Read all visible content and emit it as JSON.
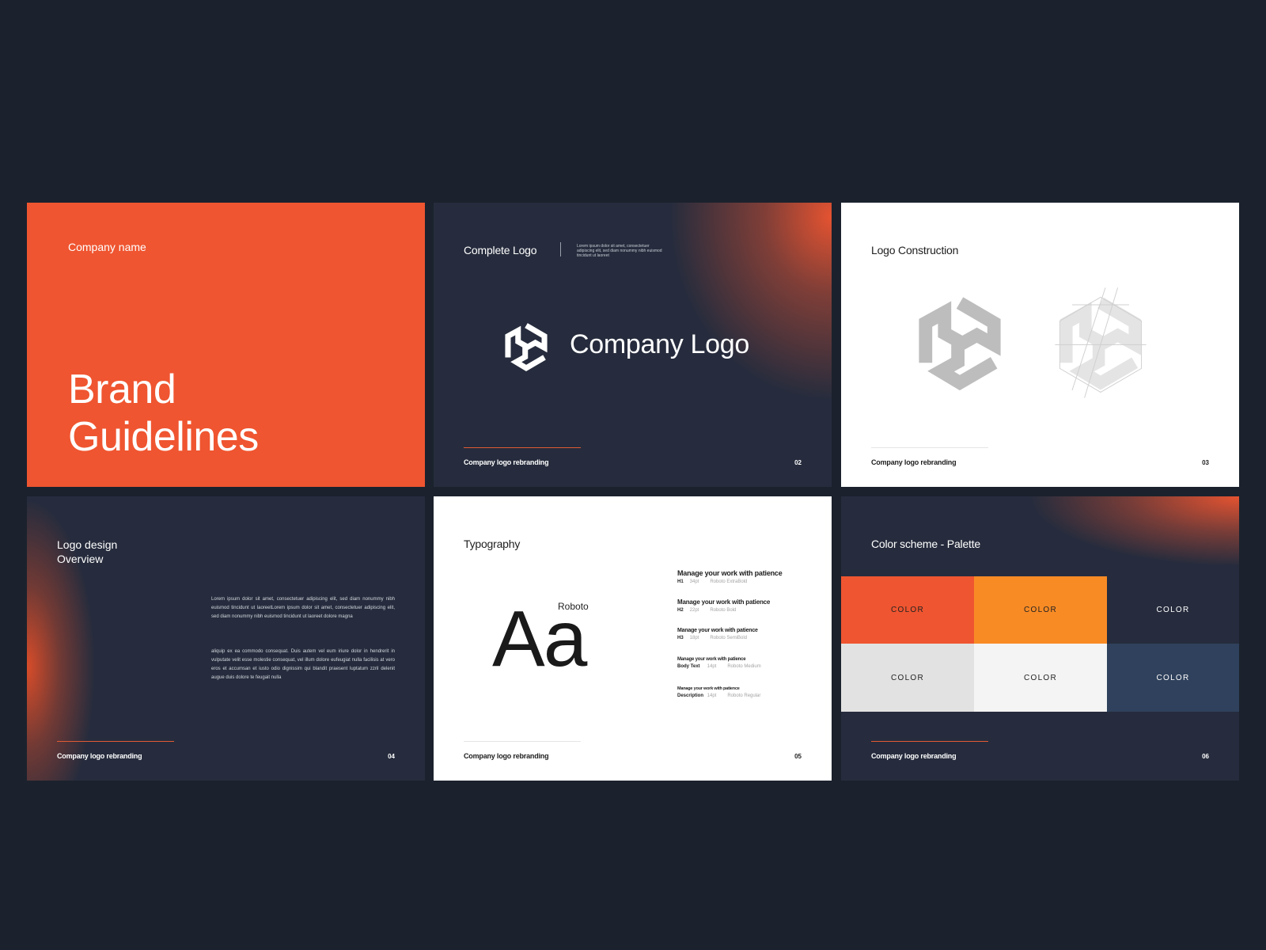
{
  "slides": {
    "cover": {
      "company_name": "Company name",
      "title_line1": "Brand",
      "title_line2": "Guidelines"
    },
    "complete_logo": {
      "title": "Complete Logo",
      "description": "Lorem ipsum dolor sit amet, consectetuer adipiscing elit, sed diam nonummy nibh euismod tincidunt ut laoreet",
      "logo_text": "Company Logo",
      "footer": "Company logo rebranding",
      "page": "02"
    },
    "logo_construction": {
      "title": "Logo Construction",
      "footer": "Company logo rebranding",
      "page": "03"
    },
    "overview": {
      "title_line1": "Logo design",
      "title_line2": "Overview",
      "paragraph1": "Lorem ipsum dolor sit amet, consectetuer adipiscing elit, sed diam nonummy nibh euismod tincidunt ut laoreetLorem ipsum dolor sit amet, consectetuer adipiscing elit, sed diam nonummy nibh euismod tincidunt ut laoreet dolore magna",
      "paragraph2": "aliquip ex ea commodo consequat. Duis autem vel eum iriure dolor in hendrerit in vulputate velit esse molestie consequat, vel illum dolore eufeugiat nulla facilisis at vero eros et accumsan et iusto odio dignissim qui blandit praesent luptatum zzril delenit augue duis dolore te feugait nulla",
      "footer": "Company logo rebranding",
      "page": "04"
    },
    "typography": {
      "title": "Typography",
      "specimen": "Aa",
      "font_name": "Roboto",
      "styles": [
        {
          "sample": "Manage your work with patience",
          "level": "H1",
          "size": "34pt",
          "weight": "Roboto ExtraBold"
        },
        {
          "sample": "Manage your work with patience",
          "level": "H2",
          "size": "22pt",
          "weight": "Roboto Bold"
        },
        {
          "sample": "Manage your work with patience",
          "level": "H3",
          "size": "18pt",
          "weight": "Roboto SemiBold"
        },
        {
          "sample": "Manage your work with patience",
          "level": "Body Text",
          "size": "14pt",
          "weight": "Roboto Medium"
        },
        {
          "sample": "Manage your work with patience",
          "level": "Description",
          "size": "14pt",
          "weight": "Roboto Regular"
        }
      ],
      "footer": "Company logo rebranding",
      "page": "05"
    },
    "palette": {
      "title": "Color scheme - Palette",
      "swatches": [
        {
          "label": "COLOR",
          "color": "#ef5530",
          "text_color": "#222222"
        },
        {
          "label": "COLOR",
          "color": "#f98b25",
          "text_color": "#222222"
        },
        {
          "label": "COLOR",
          "color": "#262c3d",
          "text_color": "#ffffff"
        },
        {
          "label": "COLOR",
          "color": "#e2e2e2",
          "text_color": "#222222"
        },
        {
          "label": "COLOR",
          "color": "#f4f4f4",
          "text_color": "#222222"
        },
        {
          "label": "COLOR",
          "color": "#2f415c",
          "text_color": "#ffffff"
        }
      ],
      "footer": "Company logo rebranding",
      "page": "06"
    }
  }
}
